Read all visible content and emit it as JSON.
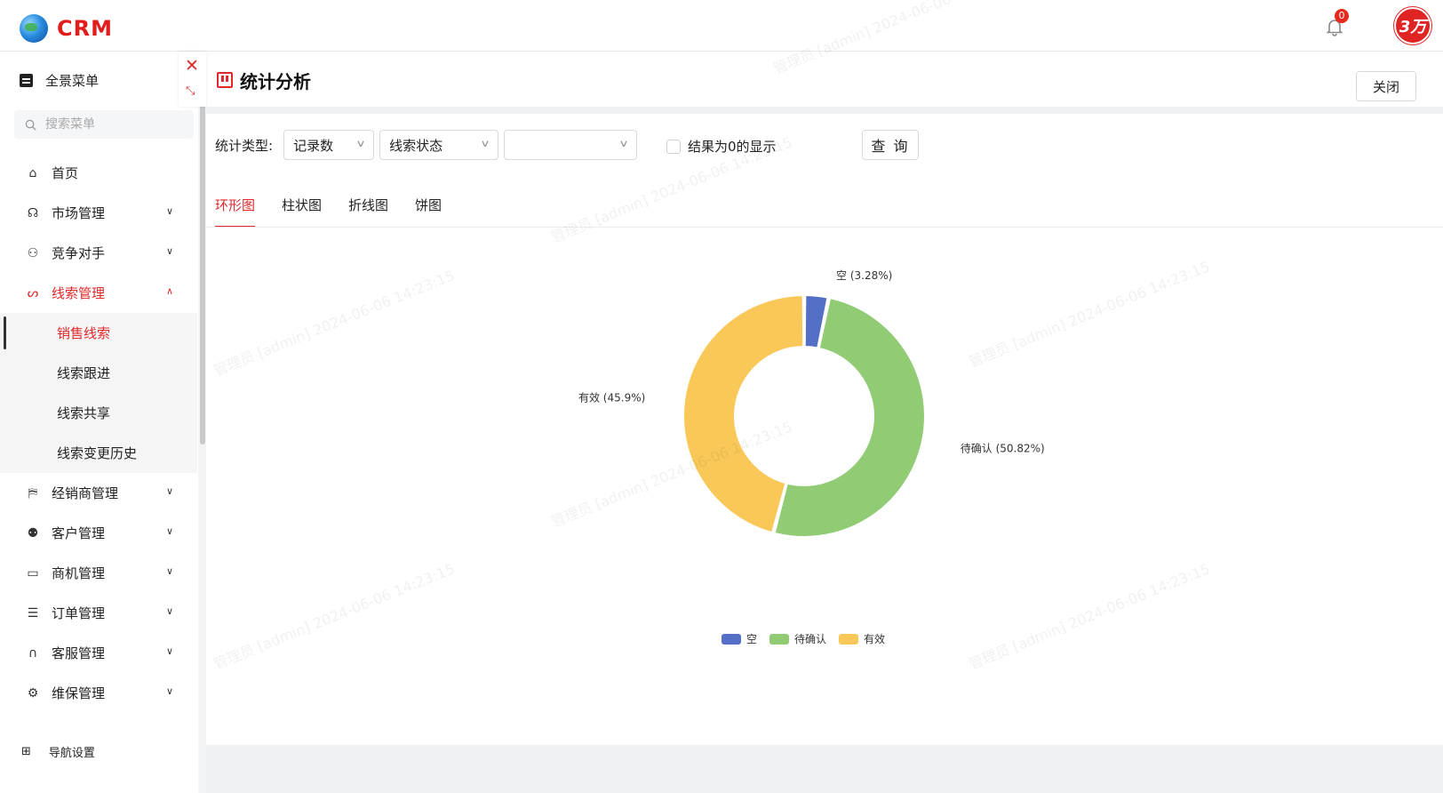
{
  "app": {
    "logo_text": "CRM",
    "notification_count": "0",
    "avatar_text": "3万"
  },
  "sidebar": {
    "full_menu_label": "全景菜单",
    "search_placeholder": "搜索菜单",
    "items": [
      {
        "label": "首页",
        "icon": "home-icon"
      },
      {
        "label": "市场管理",
        "icon": "market-icon"
      },
      {
        "label": "竞争对手",
        "icon": "competitor-icon"
      },
      {
        "label": "线索管理",
        "icon": "lead-icon"
      },
      {
        "label": "经销商管理",
        "icon": "dealer-icon"
      },
      {
        "label": "客户管理",
        "icon": "customer-icon"
      },
      {
        "label": "商机管理",
        "icon": "opportunity-icon"
      },
      {
        "label": "订单管理",
        "icon": "order-icon"
      },
      {
        "label": "客服管理",
        "icon": "service-icon"
      },
      {
        "label": "维保管理",
        "icon": "maintenance-icon"
      }
    ],
    "sub_items": [
      "销售线索",
      "线索跟进",
      "线索共享",
      "线索变更历史"
    ],
    "nav_settings_label": "导航设置"
  },
  "page": {
    "title": "统计分析",
    "close_label": "关闭"
  },
  "filter": {
    "type_label": "统计类型:",
    "select1": "记录数",
    "select2": "线索状态",
    "select3": "",
    "checkbox_label": "结果为0的显示",
    "query_label": "查 询"
  },
  "tabs": [
    "环形图",
    "柱状图",
    "折线图",
    "饼图"
  ],
  "watermark_text": "管理员 [admin] 2024-06-06 14:23:15",
  "colors": {
    "accent": "#e0292a",
    "empty": "#5470c6",
    "pending": "#91cc75",
    "valid": "#fac858"
  },
  "chart_data": {
    "type": "pie",
    "variant": "donut",
    "title": "",
    "series": [
      {
        "name": "空",
        "percent": 3.28,
        "label": "空 (3.28%)"
      },
      {
        "name": "待确认",
        "percent": 50.82,
        "label": "待确认 (50.82%)"
      },
      {
        "name": "有效",
        "percent": 45.9,
        "label": "有效 (45.9%)"
      }
    ],
    "legend": [
      "空",
      "待确认",
      "有效"
    ],
    "legend_position": "bottom"
  }
}
